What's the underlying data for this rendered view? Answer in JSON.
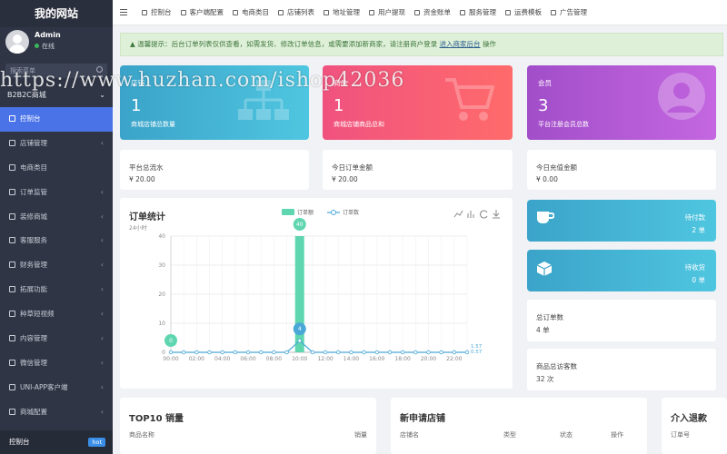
{
  "site": {
    "title": "我的网站"
  },
  "user": {
    "name": "Admin",
    "status": "在线"
  },
  "search": {
    "placeholder": "搜索菜单"
  },
  "shop_select": {
    "label": "B2B2C商城"
  },
  "sidebar": {
    "items": [
      {
        "label": "控制台",
        "active": true
      },
      {
        "label": "店铺管理"
      },
      {
        "label": "电商类目"
      },
      {
        "label": "订单监管"
      },
      {
        "label": "装修商城"
      },
      {
        "label": "客服服务"
      },
      {
        "label": "财务管理"
      },
      {
        "label": "拓展功能"
      },
      {
        "label": "种草短视频"
      },
      {
        "label": "内容管理"
      },
      {
        "label": "微信管理"
      },
      {
        "label": "UNI-APP客户端"
      },
      {
        "label": "商城配置"
      }
    ],
    "bottom": {
      "label": "控制台",
      "badge": "hot"
    }
  },
  "topbar": {
    "tabs": [
      "控制台",
      "客户端配置",
      "电商类目",
      "店铺列表",
      "地址管理",
      "用户提现",
      "资金账单",
      "服务管理",
      "运费模板",
      "广告管理"
    ]
  },
  "alert": {
    "text": "温馨提示：后台订单列表仅供查看，如需发货、修改订单信息，或需要添加新商家，请注册商户登录",
    "link": "进入商家后台",
    "suffix": "操作"
  },
  "cards": [
    {
      "title": "店铺",
      "value": "1",
      "sub": "商城店铺总数量"
    },
    {
      "title": "商品",
      "value": "1",
      "sub": "商城店铺商品总和"
    },
    {
      "title": "会员",
      "value": "3",
      "sub": "平台注册会员总数"
    }
  ],
  "info": [
    {
      "title": "平台总流水",
      "value": "¥ 20.00"
    },
    {
      "title": "今日订单金额",
      "value": "¥ 20.00"
    },
    {
      "title": "今日充值金额",
      "value": "¥ 0.00"
    }
  ],
  "chart_panel": {
    "title": "订单统计",
    "subtitle": "24小时"
  },
  "chart_data": {
    "type": "bar",
    "x": [
      "00:00",
      "01:00",
      "02:00",
      "03:00",
      "04:00",
      "05:00",
      "06:00",
      "07:00",
      "08:00",
      "09:00",
      "10:00",
      "11:00",
      "12:00",
      "13:00",
      "14:00",
      "15:00",
      "16:00",
      "17:00",
      "18:00",
      "19:00",
      "20:00",
      "21:00",
      "22:00",
      "23:00"
    ],
    "tick_labels": [
      "00:00",
      "02:00",
      "04:00",
      "06:00",
      "08:00",
      "10:00",
      "12:00",
      "14:00",
      "16:00",
      "18:00",
      "20:00",
      "22:00"
    ],
    "series": [
      {
        "name": "订单额",
        "kind": "bar",
        "color": "#5fd6b0",
        "values": [
          0,
          0,
          0,
          0,
          0,
          0,
          0,
          0,
          0,
          0,
          40,
          0,
          0,
          0,
          0,
          0,
          0,
          0,
          0,
          0,
          0,
          0,
          0,
          0
        ],
        "labels": {
          "10": "40"
        }
      },
      {
        "name": "订单数",
        "kind": "line",
        "color": "#4aa8d8",
        "values": [
          0,
          0,
          0,
          0,
          0,
          0,
          0,
          0,
          0,
          0,
          4,
          0,
          0,
          0,
          0,
          0,
          0,
          0,
          0,
          0,
          0,
          0,
          0,
          0
        ],
        "labels": {
          "0": "0",
          "10": "4"
        }
      }
    ],
    "yticks": [
      "0",
      "10",
      "20",
      "30",
      "40"
    ],
    "ylim": [
      0,
      40
    ],
    "end_labels": [
      "1.57",
      "0.57"
    ],
    "grid": true,
    "legend_position": "top-center"
  },
  "right_boxes": [
    {
      "label": "待付款",
      "value": "2 单"
    },
    {
      "label": "待收货",
      "value": "0 单"
    }
  ],
  "right_info": [
    {
      "title": "总订单数",
      "value": "4 单"
    },
    {
      "title": "商品总访客数",
      "value": "32 次"
    }
  ],
  "panels": [
    {
      "title": "TOP10 销量",
      "headers": [
        "商品名称",
        "销量"
      ]
    },
    {
      "title": "新申请店铺",
      "headers": [
        "店铺名",
        "类型",
        "状态",
        "操作"
      ]
    },
    {
      "title": "介入退款",
      "headers": [
        "订单号"
      ]
    }
  ],
  "watermark": "https://www.huzhan.com/ishop42036",
  "colors": {
    "sidebar": "#2f3545",
    "active": "#4a73e8",
    "accent_bar": "#5fd6b0",
    "accent_line": "#4aa8d8"
  }
}
